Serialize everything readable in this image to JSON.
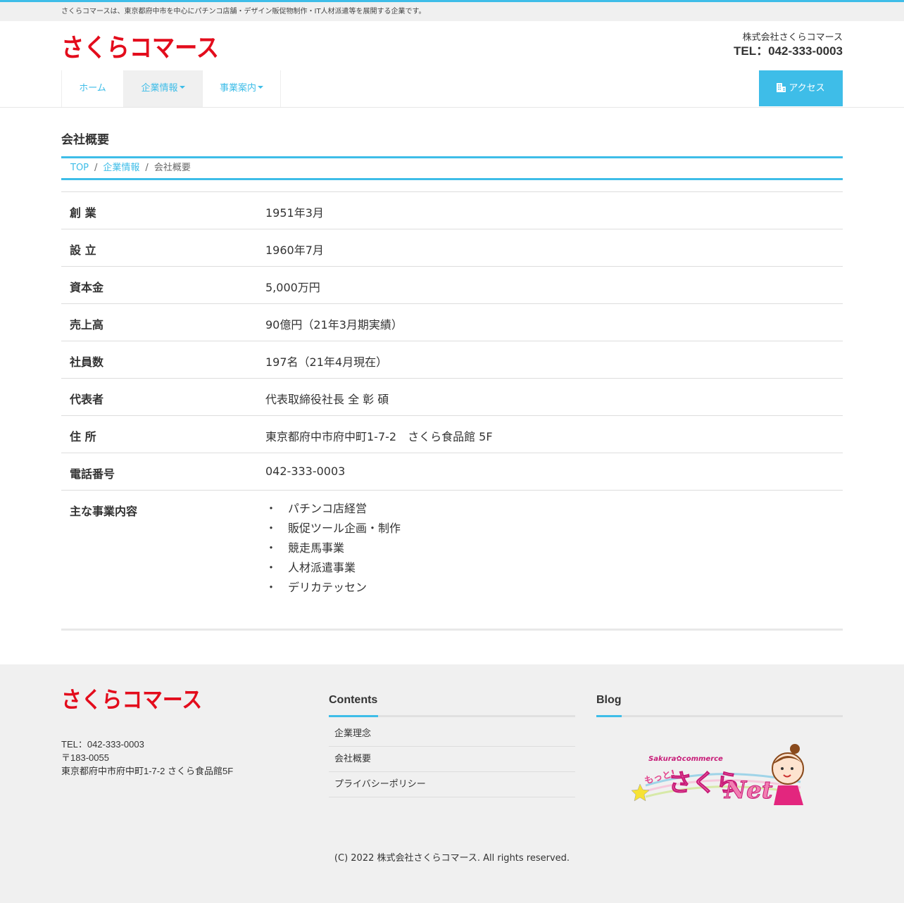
{
  "topbar": {
    "text": "さくらコマースは、東京都府中市を中心にパチンコ店舗・デザイン販促物制作・IT人材派遣等を展開する企業です。"
  },
  "header": {
    "logo_text": "さくらコマース",
    "company_name": "株式会社さくらコマース",
    "tel": "TEL：042-333-0003"
  },
  "nav": {
    "items": [
      {
        "label": "ホーム"
      },
      {
        "label": "企業情報"
      },
      {
        "label": "事業案内"
      }
    ],
    "access_label": "アクセス"
  },
  "page": {
    "title": "会社概要"
  },
  "breadcrumb": {
    "top": "TOP",
    "section": "企業情報",
    "current": "会社概要"
  },
  "info": [
    {
      "key": "創 業",
      "value": "1951年3月"
    },
    {
      "key": "設 立",
      "value": "1960年7月"
    },
    {
      "key": "資本金",
      "value": "5,000万円"
    },
    {
      "key": "売上高",
      "value": "90億円（21年3月期実績）"
    },
    {
      "key": "社員数",
      "value": "197名（21年4月現在）"
    },
    {
      "key": "代表者",
      "value": "代表取締役社長 全 彰 碩"
    },
    {
      "key": "住 所",
      "value": "東京都府中市府中町1-7-2　さくら食品館 5F"
    },
    {
      "key": "電話番号",
      "value": "042-333-0003"
    }
  ],
  "business": {
    "key": "主な事業内容",
    "bullet": "・",
    "items": [
      "パチンコ店経営",
      "販促ツール企画・制作",
      "競走馬事業",
      "人材派遣事業",
      "デリカテッセン"
    ]
  },
  "footer": {
    "logo_text": "さくらコマース",
    "tel": "TEL：042-333-0003",
    "zip": "〒183-0055",
    "address": "東京都府中市府中町1-7-2 さくら食品館5F",
    "contents_title": "Contents",
    "links": [
      "企業理念",
      "会社概要",
      "プライバシーポリシー"
    ],
    "blog_title": "Blog",
    "blog_banner": {
      "top": "Sakura✿commerce",
      "left": "もっと!",
      "main": "さくら",
      "net": "Net"
    },
    "copyright": "(C) 2022 株式会社さくらコマース. All rights reserved."
  },
  "colors": {
    "accent": "#3ebde8",
    "logo_red": "#e30c1c",
    "footer_bg": "#f0f0f0"
  }
}
